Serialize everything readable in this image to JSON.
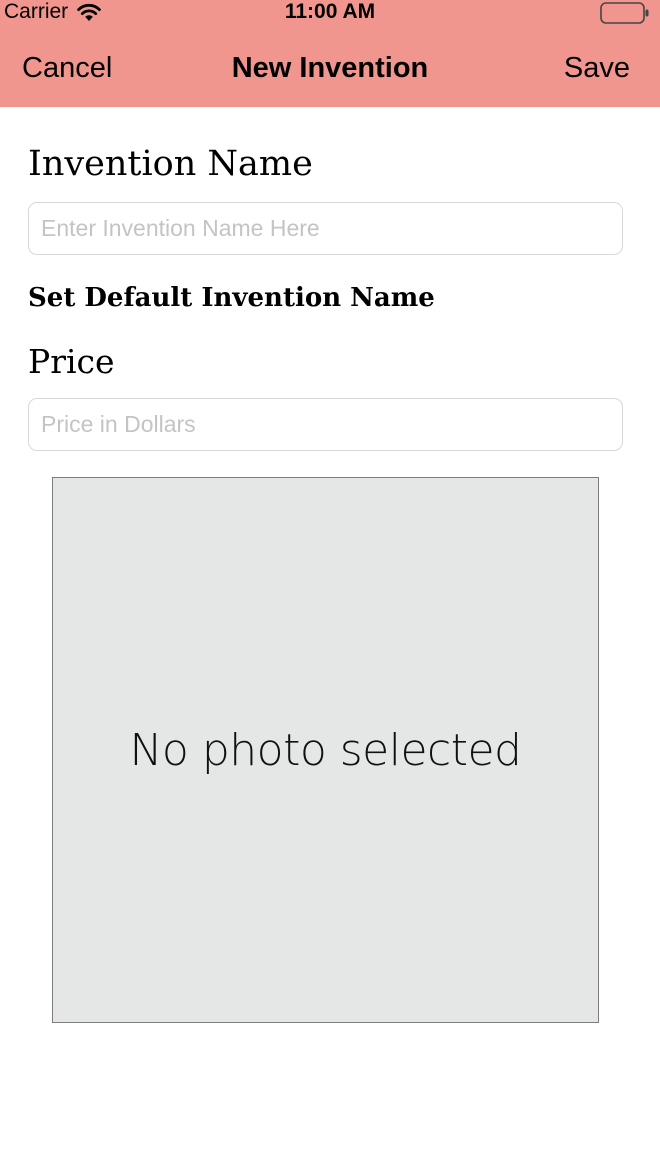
{
  "status_bar": {
    "carrier": "Carrier",
    "time": "11:00 AM",
    "wifi_icon": "wifi-icon",
    "battery_icon": "battery-empty-icon"
  },
  "nav": {
    "cancel_label": "Cancel",
    "title": "New Invention",
    "save_label": "Save",
    "background_color": "#f1968f"
  },
  "form": {
    "name_label": "Invention Name",
    "name_input": {
      "value": "",
      "placeholder": "Enter Invention Name Here"
    },
    "set_default_label": "Set Default Invention Name",
    "price_label": "Price",
    "price_input": {
      "value": "",
      "placeholder": "Price in Dollars"
    }
  },
  "photo": {
    "placeholder_text": "No photo selected",
    "background_color": "#e5e7e6"
  }
}
